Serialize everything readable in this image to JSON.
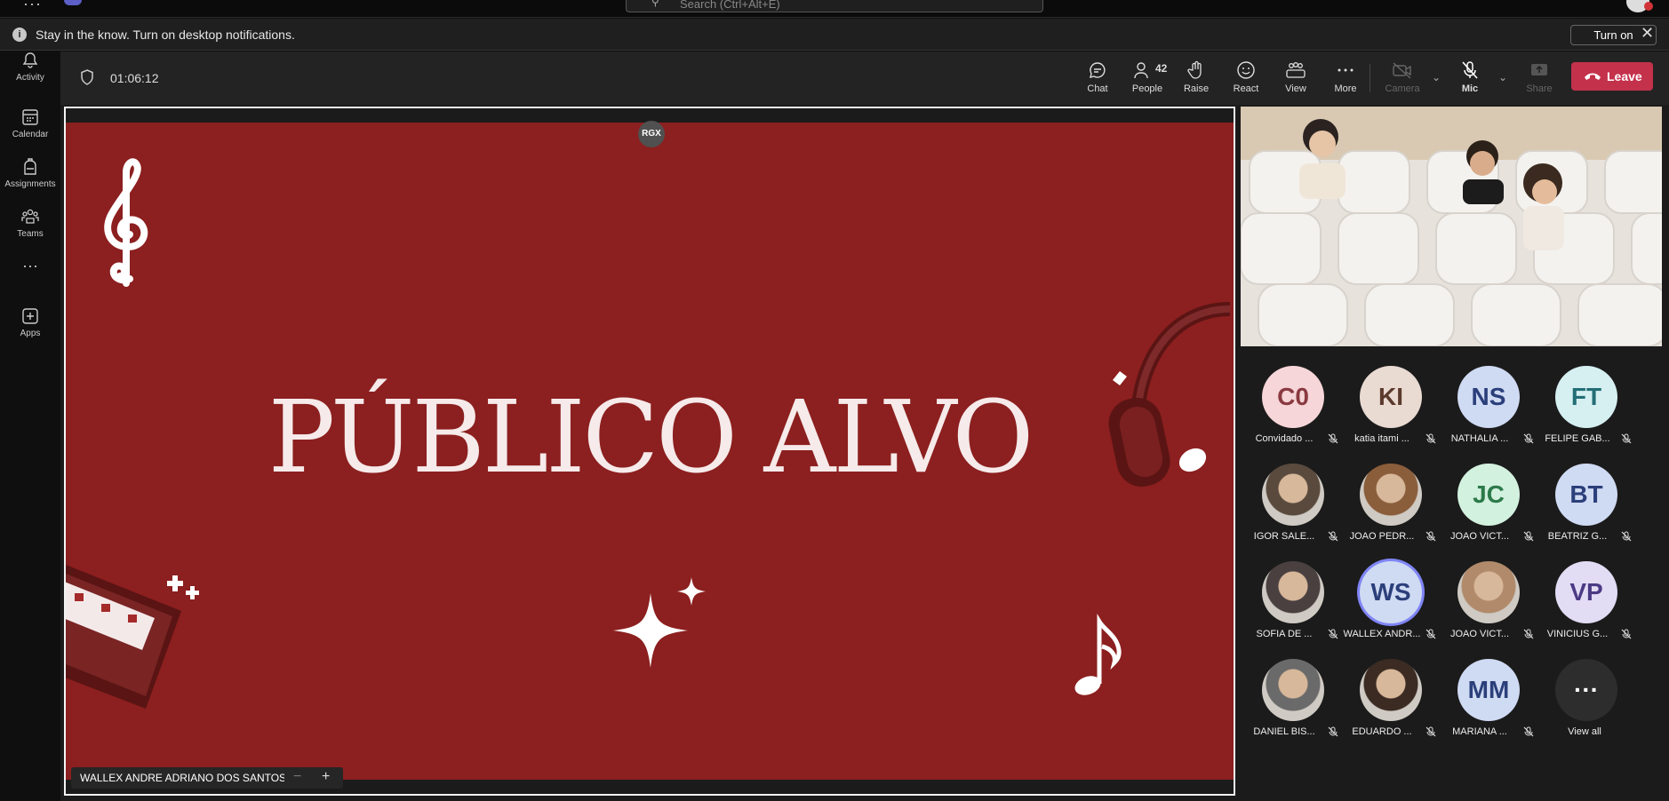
{
  "search": {
    "placeholder": "Search (Ctrl+Alt+E)"
  },
  "notification": {
    "message": "Stay in the know. Turn on desktop notifications.",
    "turn_on": "Turn on"
  },
  "rail": {
    "items": [
      {
        "label": "Activity",
        "icon": "bell-icon"
      },
      {
        "label": "Calendar",
        "icon": "calendar-icon"
      },
      {
        "label": "Assignments",
        "icon": "backpack-icon"
      },
      {
        "label": "Teams",
        "icon": "teams-icon"
      },
      {
        "label": "",
        "icon": "more-icon"
      },
      {
        "label": "Apps",
        "icon": "plus-square-icon"
      }
    ]
  },
  "meeting": {
    "timer": "01:06:12",
    "toolbar": {
      "chat": "Chat",
      "people": "People",
      "people_count": "42",
      "raise": "Raise",
      "react": "React",
      "view": "View",
      "more": "More",
      "camera": "Camera",
      "mic": "Mic",
      "share": "Share",
      "leave": "Leave"
    }
  },
  "stage": {
    "presenter_badge": "RGX",
    "slide_title": "PÚBLICO ALVO",
    "presenter_name": "WALLEX ANDRE ADRIANO DOS SANTOS",
    "zoom_out": "−",
    "zoom_in": "+"
  },
  "participants": [
    {
      "initials": "C0",
      "name": "Convidado ...",
      "bg": "#f6d6d8",
      "fg": "#8a3a41"
    },
    {
      "initials": "KI",
      "name": "katia itami ...",
      "bg": "#e9dad2",
      "fg": "#5b3a2c"
    },
    {
      "initials": "NS",
      "name": "NATHALIA ...",
      "bg": "#cfdaf3",
      "fg": "#2b3f7a"
    },
    {
      "initials": "FT",
      "name": "FELIPE GAB...",
      "bg": "#d6f0f2",
      "fg": "#246e76"
    },
    {
      "initials": "",
      "name": "IGOR SALE...",
      "photo": true
    },
    {
      "initials": "",
      "name": "JOAO PEDR...",
      "photo": true
    },
    {
      "initials": "JC",
      "name": "JOAO VICT...",
      "bg": "#d3f1df",
      "fg": "#2c7a4a"
    },
    {
      "initials": "BT",
      "name": "BEATRIZ G...",
      "bg": "#cfdaf3",
      "fg": "#2b3f7a"
    },
    {
      "initials": "",
      "name": "SOFIA DE ...",
      "photo": true
    },
    {
      "initials": "WS",
      "name": "WALLEX ANDR...",
      "bg": "#cfdaf3",
      "fg": "#2b3f7a",
      "speaking": true
    },
    {
      "initials": "",
      "name": "JOAO VICT...",
      "photo": true
    },
    {
      "initials": "VP",
      "name": "VINICIUS G...",
      "bg": "#e3dcf5",
      "fg": "#4b3a84"
    },
    {
      "initials": "",
      "name": "DANIEL BIS...",
      "photo": true
    },
    {
      "initials": "",
      "name": "EDUARDO ...",
      "photo": true
    },
    {
      "initials": "MM",
      "name": "MARIANA ...",
      "bg": "#cfdaf3",
      "fg": "#2b3f7a"
    },
    {
      "initials": "···",
      "name": "View all",
      "bg": "#2d2d2d",
      "fg": "#ffffff"
    }
  ],
  "colors": {
    "leave": "#c4314b",
    "slide_bg": "#8c1f1f",
    "speaking_ring": "#7f85f5"
  }
}
